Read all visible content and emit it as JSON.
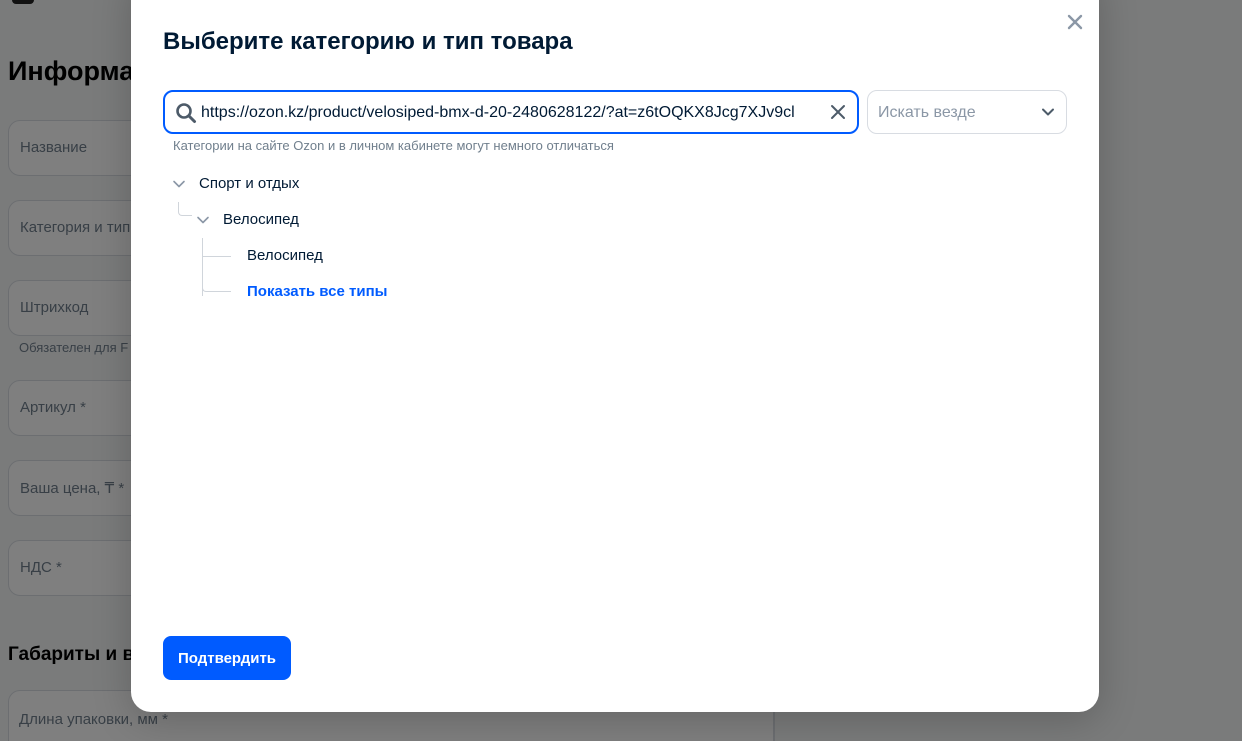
{
  "background": {
    "heading": "Информац",
    "fields": [
      {
        "label": "Название"
      },
      {
        "label": "Категория и тип"
      },
      {
        "label": "Штрихкод"
      },
      {
        "label": "Артикул *"
      },
      {
        "label": "Ваша цена, ₸ *"
      },
      {
        "label": "НДС *"
      }
    ],
    "barcode_hint": "Обязателен для F",
    "subheading": "Габариты и ве",
    "length_field": "Длина упаковки, мм *"
  },
  "modal": {
    "title": "Выберите категорию и тип товара",
    "search": {
      "value": "https://ozon.kz/product/velosiped-bmx-d-20-2480628122/?at=z6tOQKX8Jcg7XJv9cl",
      "icon": "search-icon"
    },
    "scope_select": {
      "value": "Искать везде"
    },
    "hint": "Категории на сайте Ozon и в личном кабинете могут немного отличаться",
    "tree": {
      "level1": "Спорт и отдых",
      "level2": "Велосипед",
      "level3": "Велосипед",
      "show_all": "Показать все типы"
    },
    "confirm_label": "Подтвердить"
  },
  "colors": {
    "accent": "#005bff",
    "overlay": "rgba(0,0,0,0.5)"
  }
}
